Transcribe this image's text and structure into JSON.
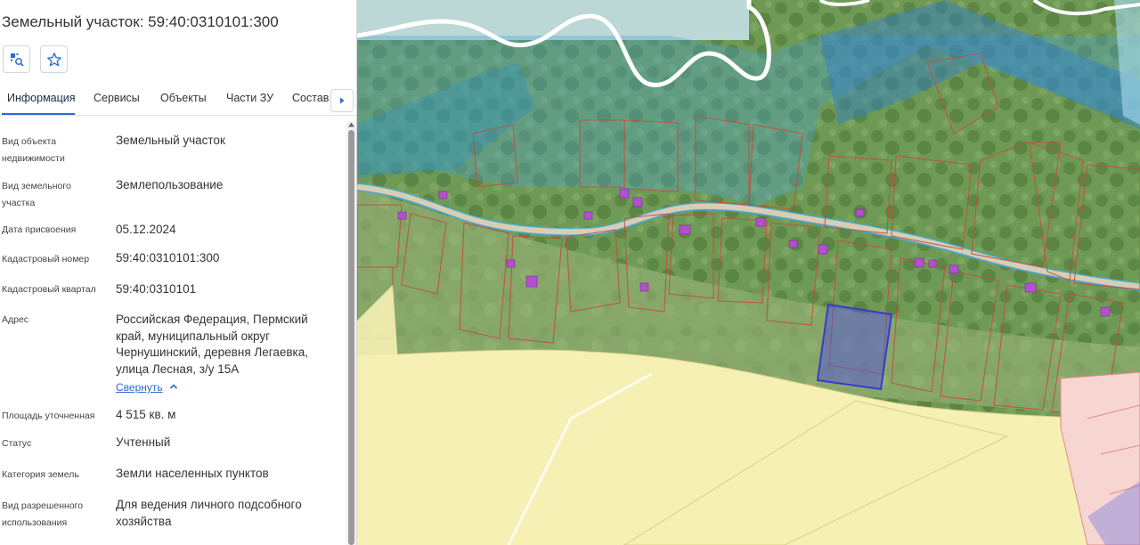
{
  "header": {
    "title": "Земельный участок: 59:40:0310101:300"
  },
  "toolbar": {
    "locate_icon": "locate-on-map-icon",
    "favorite_icon": "star-icon"
  },
  "tabs": [
    {
      "label": "Информация",
      "active": true
    },
    {
      "label": "Сервисы",
      "active": false
    },
    {
      "label": "Объекты",
      "active": false
    },
    {
      "label": "Части ЗУ",
      "active": false
    },
    {
      "label": "Состав",
      "active": false
    }
  ],
  "properties": [
    {
      "label": "Вид объекта недвижимости",
      "value": "Земельный участок"
    },
    {
      "label": "Вид земельного участка",
      "value": "Землепользование"
    },
    {
      "label": "Дата присвоения",
      "value": "05.12.2024"
    },
    {
      "label": "Кадастровый номер",
      "value": "59:40:0310101:300"
    },
    {
      "label": "Кадастровый квартал",
      "value": "59:40:0310101"
    },
    {
      "label": "Адрес",
      "value": "Российская Федерация, Пермский край, муниципальный округ Чернушинский, деревня Легаевка, улица Лесная, з/у 15А"
    },
    {
      "label": "Площадь уточненная",
      "value": "4 515 кв. м"
    },
    {
      "label": "Статус",
      "value": "Учтенный"
    },
    {
      "label": "Категория земель",
      "value": "Земли населенных пунктов"
    },
    {
      "label": "Вид разрешенного использования",
      "value": "Для ведения личного подсобного хозяйства"
    }
  ],
  "address_collapse_label": "Свернуть",
  "colors": {
    "accent": "#2a6bd4",
    "selected_parcel": "#3a3acc",
    "parcel_border": "#c0503a",
    "water_zone": "#4aa3d8",
    "field": "#f6f0b4"
  }
}
